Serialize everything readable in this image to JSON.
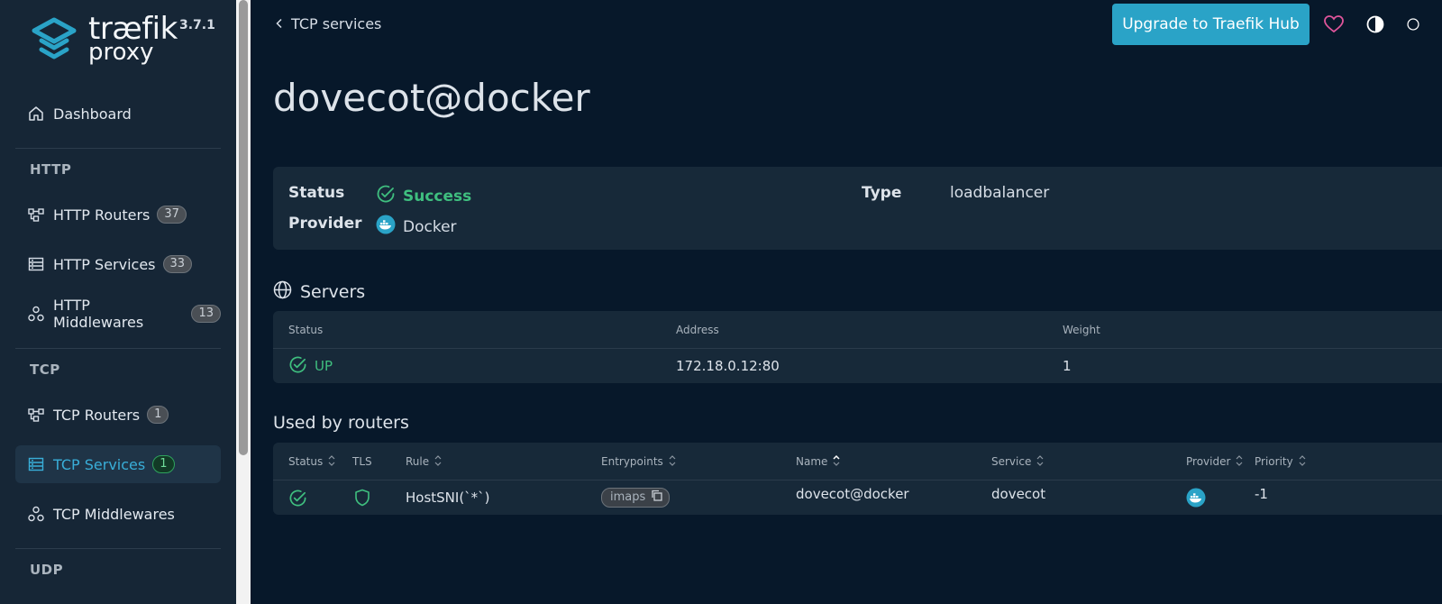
{
  "app": {
    "logo_word": "træfik",
    "logo_sub": "proxy",
    "version": "3.7.1"
  },
  "sidebar": {
    "dashboard": "Dashboard",
    "sections": {
      "http": "HTTP",
      "tcp": "TCP",
      "udp": "UDP"
    },
    "items": [
      {
        "label": "HTTP Routers",
        "count": "37"
      },
      {
        "label": "HTTP Services",
        "count": "33"
      },
      {
        "label": "HTTP Middlewares",
        "count": "13"
      },
      {
        "label": "TCP Routers",
        "count": "1"
      },
      {
        "label": "TCP Services",
        "count": "1"
      },
      {
        "label": "TCP Middlewares"
      }
    ]
  },
  "header": {
    "back_label": "TCP services",
    "upgrade_label": "Upgrade to Traefik Hub"
  },
  "page": {
    "title": "dovecot@docker"
  },
  "info": {
    "status_label": "Status",
    "status_value": "Success",
    "provider_label": "Provider",
    "provider_value": "Docker",
    "type_label": "Type",
    "type_value": "loadbalancer"
  },
  "servers": {
    "title": "Servers",
    "columns": [
      "Status",
      "Address",
      "Weight"
    ],
    "rows": [
      {
        "status": "UP",
        "address": "172.18.0.12:80",
        "weight": "1"
      }
    ]
  },
  "routers": {
    "title": "Used by routers",
    "columns": [
      "Status",
      "TLS",
      "Rule",
      "Entrypoints",
      "Name",
      "Service",
      "Provider",
      "Priority"
    ],
    "rows": [
      {
        "rule": "HostSNI(`*`)",
        "entrypoint": "imaps",
        "name": "dovecot@docker",
        "service": "dovecot",
        "priority": "-1"
      }
    ]
  },
  "colors": {
    "accent": "#2aa3c7",
    "success": "#3fbf7f",
    "favorite": "#e0559b",
    "background": "#07182a",
    "sidebar": "#162636"
  },
  "icons": [
    "home-icon",
    "router-icon",
    "service-icon",
    "middleware-icon",
    "chevron-left-icon",
    "heart-icon",
    "contrast-icon",
    "check-circle-icon",
    "docker-icon",
    "globe-icon",
    "shield-icon",
    "copy-icon",
    "sort-icon"
  ]
}
